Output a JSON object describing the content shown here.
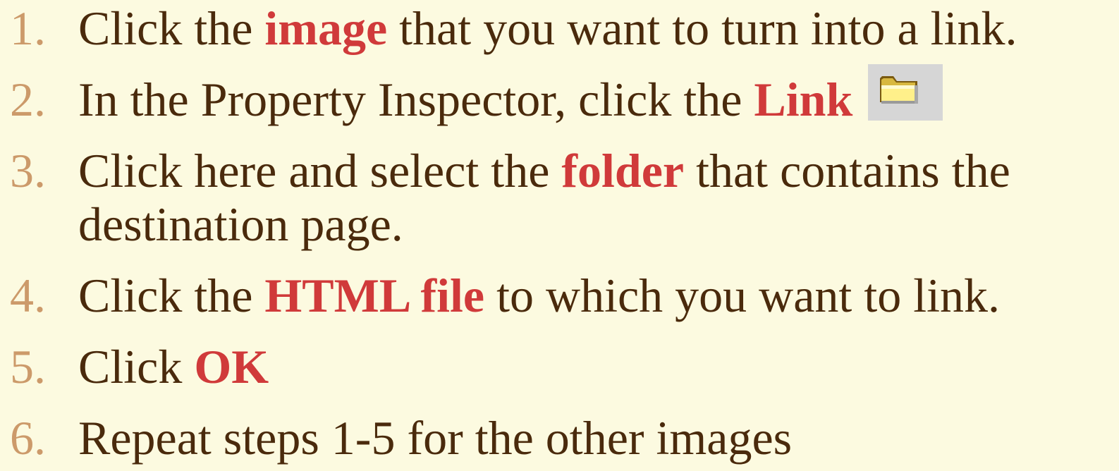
{
  "steps": [
    {
      "number": "1.",
      "before": "Click the ",
      "highlight": "image",
      "after": " that you want to turn into a link."
    },
    {
      "number": "2.",
      "before": "In the Property Inspector, click the ",
      "highlight": "Link",
      "after": "",
      "icon": "folder-icon"
    },
    {
      "number": "3.",
      "before": "Click here and select the ",
      "highlight": "folder",
      "after": " that contains the",
      "continuation": "destination page."
    },
    {
      "number": "4.",
      "before": "Click the ",
      "highlight": "HTML file",
      "after": " to which you want to link."
    },
    {
      "number": "5.",
      "before": "Click ",
      "highlight": "OK",
      "after": ""
    },
    {
      "number": "6.",
      "before": "Repeat steps 1-5 for the other images",
      "highlight": "",
      "after": ""
    }
  ],
  "colors": {
    "background": "#fcfae0",
    "text": "#4a2a0c",
    "number": "#cc9a6a",
    "highlight": "#d03a3a",
    "icon_button_bg": "#d6d6d6"
  }
}
